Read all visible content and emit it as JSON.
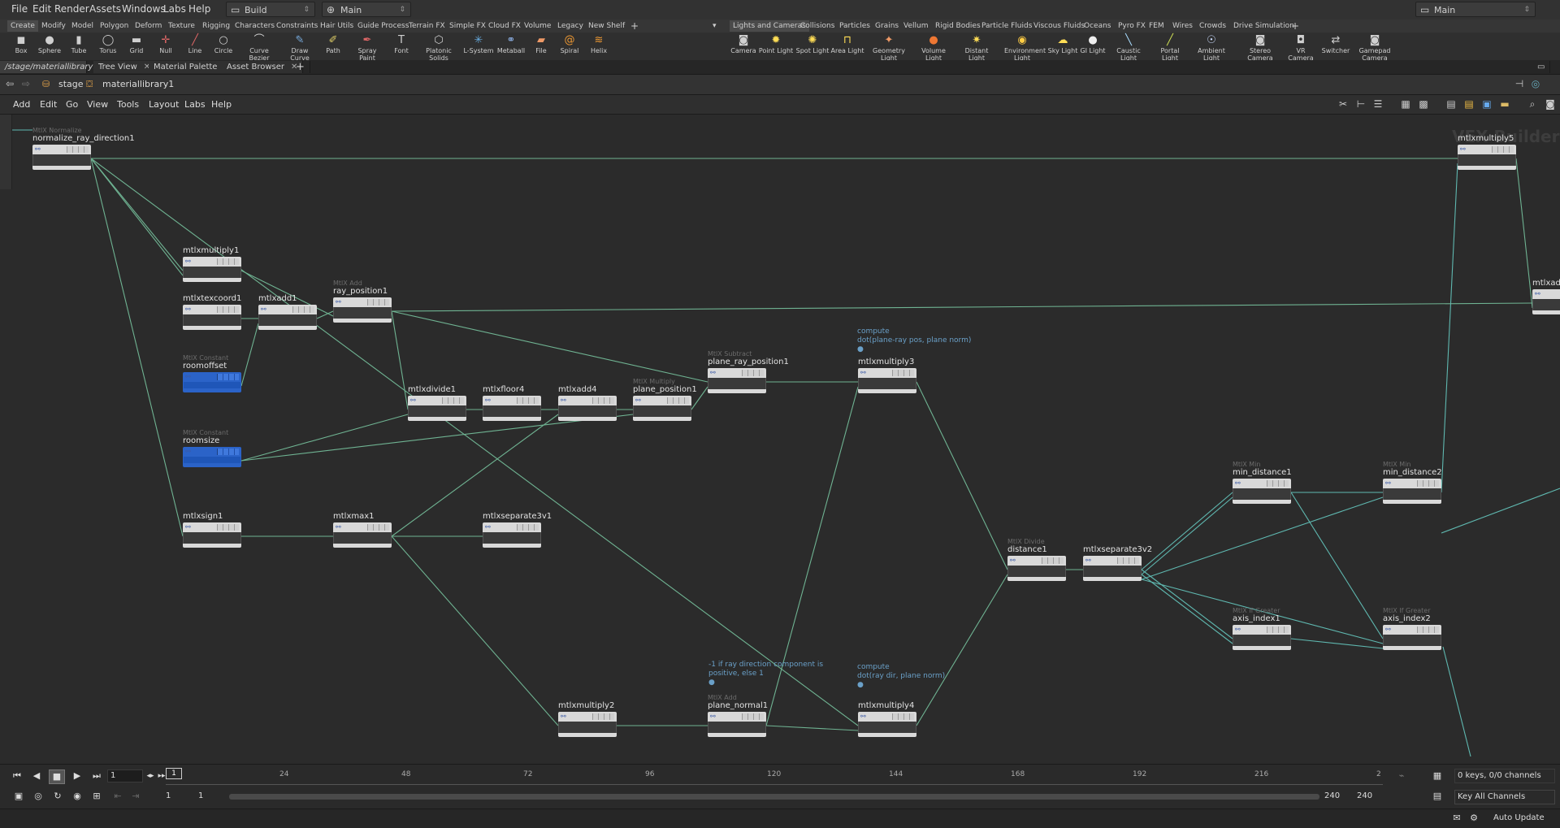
{
  "menu": {
    "items": [
      "File",
      "Edit",
      "Render",
      "Assets",
      "Windows",
      "Labs",
      "Help"
    ],
    "desktop": "Build",
    "context": "Main",
    "right_context": "Main"
  },
  "shelf": {
    "left_tabs": [
      "Create",
      "Modify",
      "Model",
      "Polygon",
      "Deform",
      "Texture",
      "Rigging",
      "Characters",
      "Constraints",
      "Hair Utils",
      "Guide Process",
      "Terrain FX",
      "Simple FX",
      "Cloud FX",
      "Volume",
      "Legacy",
      "New Shelf"
    ],
    "right_tabs": [
      "Lights and Cameras",
      "Collisions",
      "Particles",
      "Grains",
      "Vellum",
      "Rigid Bodies",
      "Particle Fluids",
      "Viscous Fluids",
      "Oceans",
      "Pyro FX",
      "FEM",
      "Wires",
      "Crowds",
      "Drive Simulation"
    ],
    "left_tools": [
      "Box",
      "Sphere",
      "Tube",
      "Torus",
      "Grid",
      "Null",
      "Line",
      "Circle",
      "Curve Bezier",
      "Draw Curve",
      "Path",
      "Spray Paint",
      "Font",
      "Platonic Solids",
      "L-System",
      "Metaball",
      "File",
      "Spiral",
      "Helix"
    ],
    "right_tools": [
      "Camera",
      "Point Light",
      "Spot Light",
      "Area Light",
      "Geometry Light",
      "Volume Light",
      "Distant Light",
      "Environment Light",
      "Sky Light",
      "GI Light",
      "Caustic Light",
      "Portal Light",
      "Ambient Light",
      "Stereo Camera",
      "VR Camera",
      "Switcher",
      "Gamepad Camera"
    ]
  },
  "pane_tabs": [
    "/stage/materiallibrary1",
    "Tree View",
    "Material Palette",
    "Asset Browser"
  ],
  "path": {
    "root": "stage",
    "child": "materiallibrary1"
  },
  "network_menu": [
    "Add",
    "Edit",
    "Go",
    "View",
    "Tools",
    "Layout",
    "Labs",
    "Help"
  ],
  "watermark": "VEX Builder",
  "nodes": [
    {
      "category": "MtlX Normalize",
      "name": "normalize_ray_direction1"
    },
    {
      "category": "",
      "name": "mtlxmultiply1"
    },
    {
      "category": "",
      "name": "mtlxtexcoord1"
    },
    {
      "category": "",
      "name": "mtlxadd1"
    },
    {
      "category": "MtlX Add",
      "name": "ray_position1"
    },
    {
      "category": "MtlX Constant",
      "name": "roomoffset"
    },
    {
      "category": "MtlX Constant",
      "name": "roomsize"
    },
    {
      "category": "",
      "name": "mtlxdivide1"
    },
    {
      "category": "",
      "name": "mtlxfloor4"
    },
    {
      "category": "",
      "name": "mtlxadd4"
    },
    {
      "category": "MtlX Multiply",
      "name": "plane_position1"
    },
    {
      "category": "MtlX Subtract",
      "name": "plane_ray_position1"
    },
    {
      "category": "",
      "name": "mtlxmultiply3"
    },
    {
      "category": "",
      "name": "mtlxsign1"
    },
    {
      "category": "",
      "name": "mtlxmax1"
    },
    {
      "category": "",
      "name": "mtlxseparate3v1"
    },
    {
      "category": "",
      "name": "mtlxmultiply2"
    },
    {
      "category": "MtlX Add",
      "name": "plane_normal1"
    },
    {
      "category": "",
      "name": "mtlxmultiply4"
    },
    {
      "category": "MtlX Divide",
      "name": "distance1"
    },
    {
      "category": "",
      "name": "mtlxseparate3v2"
    },
    {
      "category": "MtlX Min",
      "name": "min_distance1"
    },
    {
      "category": "MtlX Min",
      "name": "min_distance2"
    },
    {
      "category": "MtlX If Greater",
      "name": "axis_index1"
    },
    {
      "category": "MtlX If Greater",
      "name": "axis_index2"
    },
    {
      "category": "",
      "name": "mtlxmultiply5"
    },
    {
      "category": "",
      "name": "mtlxadd"
    }
  ],
  "comments": [
    "compute\ndot(plane-ray pos, plane norm)",
    "-1 if ray direction component is\npositive, else 1",
    "compute\ndot(ray dir, plane norm)"
  ],
  "timeline": {
    "ticks": [
      "24",
      "48",
      "72",
      "96",
      "120",
      "144",
      "168",
      "192",
      "216",
      "2"
    ],
    "current_frame": "1",
    "frame_marker": "1",
    "range_start": "1",
    "range_start2": "1",
    "range_end": "240",
    "range_end2": "240",
    "keys_label": "0 keys, 0/0 channels",
    "key_all": "Key All Channels"
  },
  "status": {
    "auto_update": "Auto Update"
  },
  "colors": {
    "wire": "#6fb392",
    "wire_teal": "#5fb8b0",
    "constant_node": "#2b63c8",
    "comment": "#6aa0c8"
  }
}
